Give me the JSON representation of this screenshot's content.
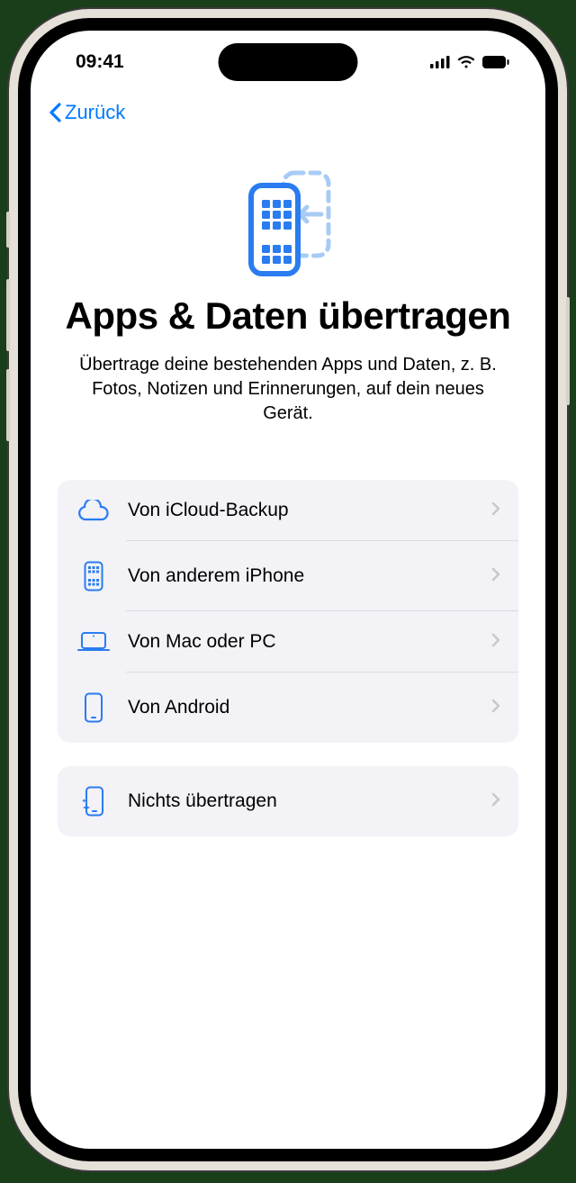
{
  "status": {
    "time": "09:41"
  },
  "nav": {
    "back": "Zurück"
  },
  "header": {
    "title": "Apps & Daten übertragen",
    "subtitle": "Übertrage deine bestehenden Apps und Daten, z. B. Fotos, Notizen und Erinnerungen, auf dein neues Gerät."
  },
  "options": [
    {
      "label": "Von iCloud-Backup"
    },
    {
      "label": "Von anderem iPhone"
    },
    {
      "label": "Von Mac oder PC"
    },
    {
      "label": "Von Android"
    }
  ],
  "skip": {
    "label": "Nichts übertragen"
  }
}
